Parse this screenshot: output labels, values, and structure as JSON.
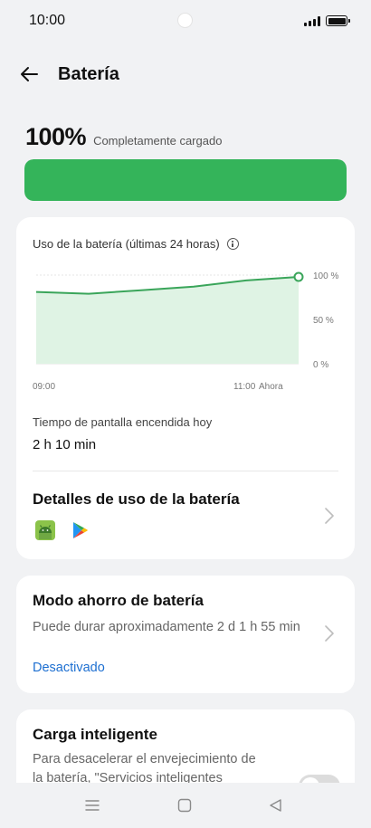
{
  "status_bar": {
    "time": "10:00"
  },
  "header": {
    "title": "Batería"
  },
  "battery": {
    "percent": "100%",
    "percent_value": 100,
    "status": "Completamente cargado"
  },
  "usage_card": {
    "title": "Uso de la batería (últimas 24 horas)",
    "screen_time_label": "Tiempo de pantalla encendida hoy",
    "screen_time_value": "2 h 10 min",
    "details_title": "Detalles de uso de la batería",
    "app_icons": [
      "android-icon",
      "play-store-icon"
    ]
  },
  "chart_data": {
    "type": "area",
    "x_tick_labels": [
      "09:00",
      "11:00",
      "Ahora"
    ],
    "y_tick_labels": [
      "100 %",
      "50 %",
      "0 %"
    ],
    "ylim": [
      0,
      100
    ],
    "series": [
      {
        "values": [
          81,
          79,
          83,
          87,
          94,
          98
        ]
      }
    ],
    "grid": true,
    "line_color": "#3aa55a",
    "fill_color": "#dff3e4"
  },
  "saver_card": {
    "title": "Modo ahorro de batería",
    "description": "Puede durar aproximadamente 2 d 1 h 55 min",
    "status": "Desactivado"
  },
  "smart_card": {
    "title": "Carga inteligente",
    "description": "Para desacelerar el envejecimiento de la batería, \"Servicios inteligentes",
    "enabled": false
  },
  "nav_bar": {
    "buttons": [
      "menu-icon",
      "home-icon",
      "back-triangle-icon"
    ]
  },
  "colors": {
    "accent": "#34b45a",
    "link": "#1d6fd1",
    "background": "#f1f2f4"
  }
}
